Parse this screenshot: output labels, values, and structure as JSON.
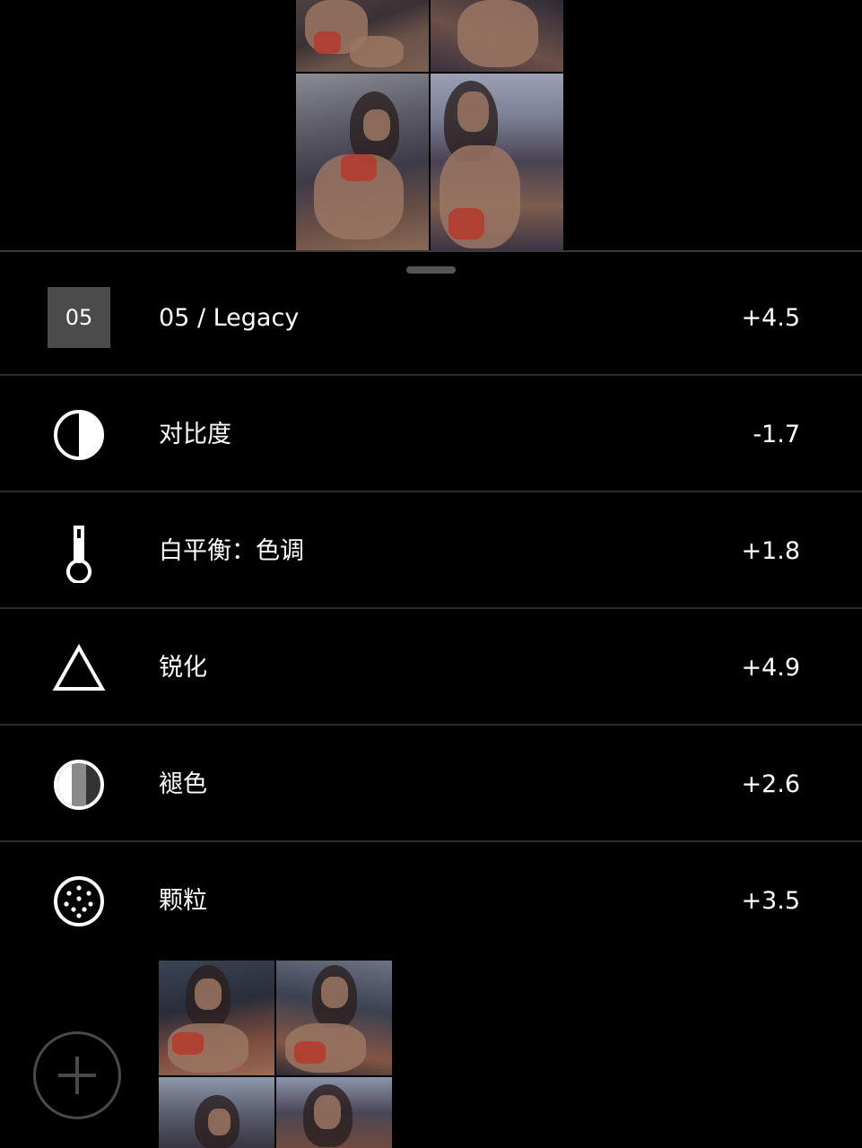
{
  "preset": {
    "badge": "05",
    "name": "05 / Legacy",
    "value": "+4.5"
  },
  "adjustments": [
    {
      "icon": "contrast-icon",
      "label": "对比度",
      "value": "-1.7"
    },
    {
      "icon": "thermometer-icon",
      "label": "白平衡：色调",
      "value": "+1.8"
    },
    {
      "icon": "sharpen-triangle-icon",
      "label": "锐化",
      "value": "+4.9"
    },
    {
      "icon": "fade-icon",
      "label": "褪色",
      "value": "+2.6"
    },
    {
      "icon": "grain-icon",
      "label": "颗粒",
      "value": "+3.5"
    }
  ],
  "colors": {
    "background": "#000000",
    "divider": "#2a2a2a",
    "badge": "#4b4b4b",
    "text": "#ffffff"
  }
}
